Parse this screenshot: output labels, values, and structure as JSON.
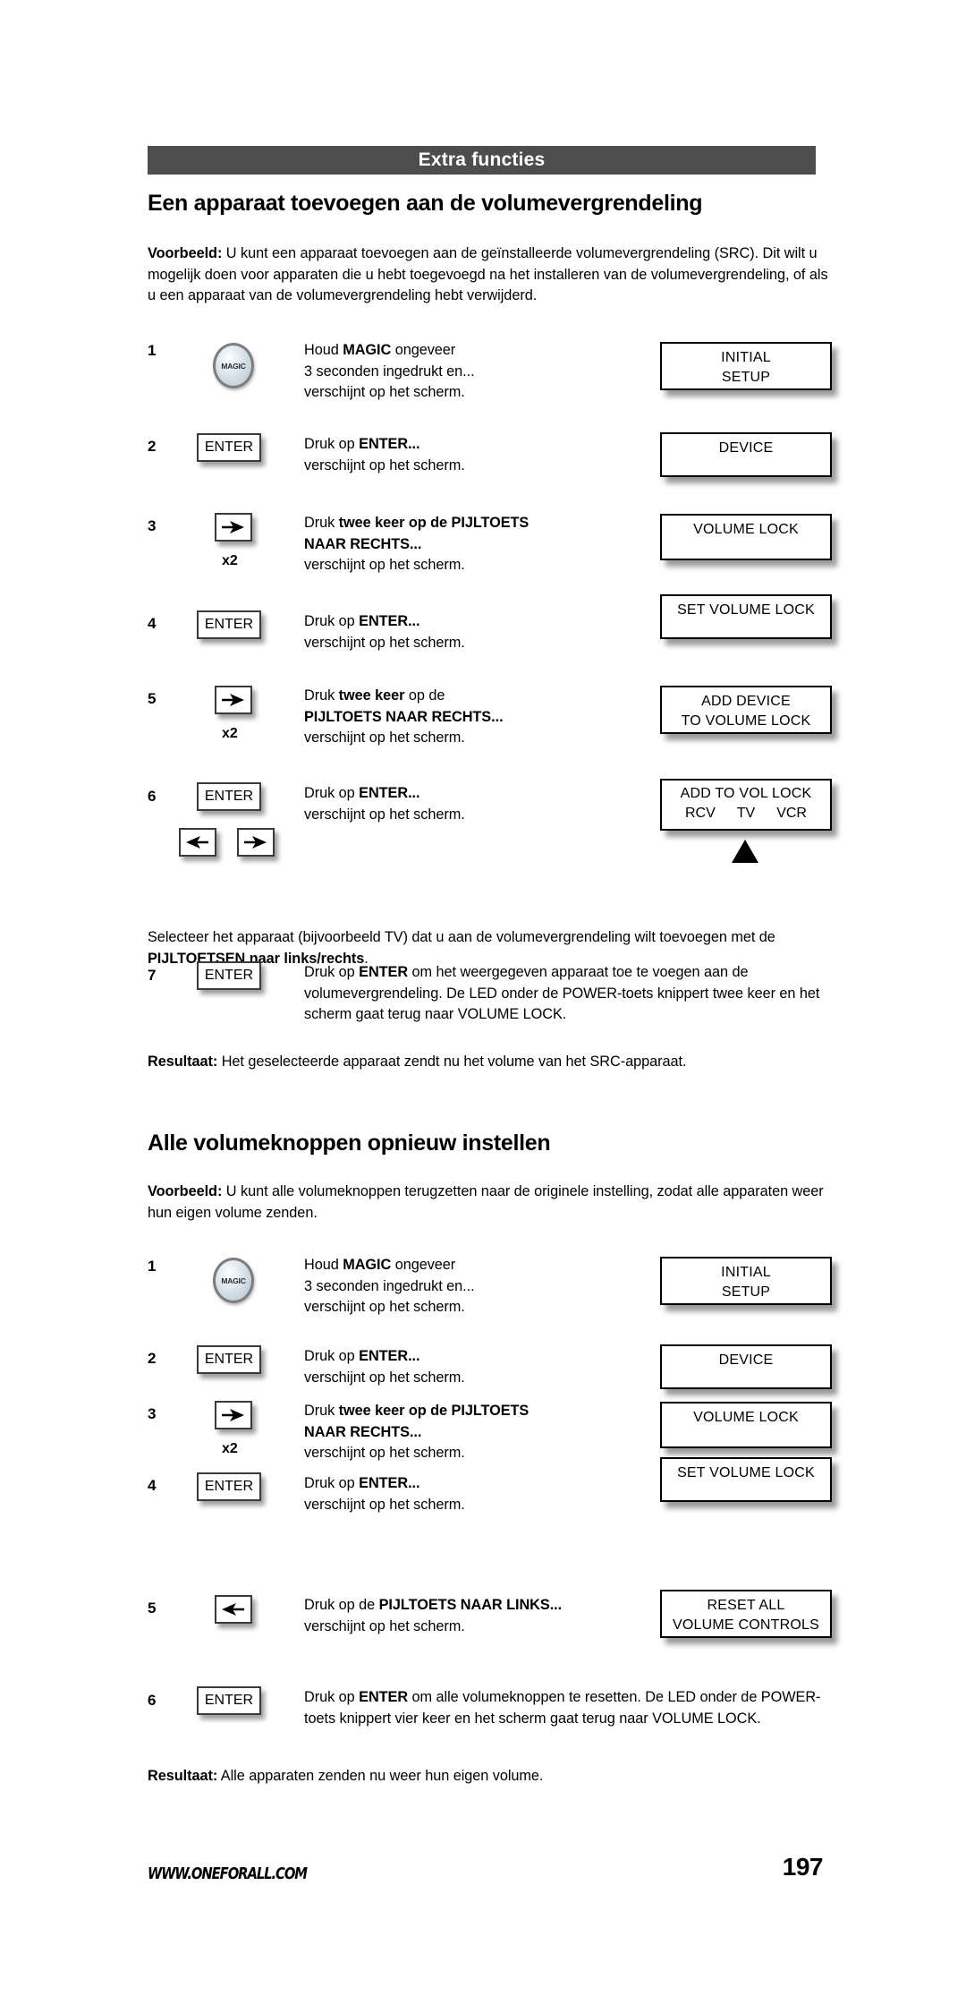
{
  "header": {
    "title": "Extra functies"
  },
  "footer": {
    "url": "WWW.ONEFORALL.COM",
    "page_number": "197"
  },
  "colors": {
    "header_bar": "#4d4d4d",
    "header_text": "#ffffff",
    "body_text": "#000000",
    "magic_key": "#cdd9e0"
  },
  "sections": [
    {
      "heading": "Een apparaat toevoegen aan de volumevergrendeling",
      "intro_label": "Voorbeeld:",
      "intro_text": " U kunt een apparaat toevoegen aan de geïnstalleerde volumevergrendeling (SRC). Dit wilt u mogelijk doen voor apparaten die u hebt toegevoegd na het installeren van de volumevergrendeling, of als u een apparaat van de volumevergrendeling hebt verwijderd.",
      "mid_text_pre": "Selecteer het apparaat (bijvoorbeeld TV) dat u aan de volumevergrendeling wilt toevoegen met de ",
      "mid_text_bold": "PIJLTOETSEN naar links/rechts",
      "mid_text_post": ".",
      "result_label": "Resultaat:",
      "result_text": " Het geselecteerde apparaat zendt nu het volume van het SRC-apparaat.",
      "steps": [
        {
          "number": "1",
          "key": "magic",
          "key_label": "MAGIC",
          "text_html": "Houd <b>MAGIC</b> ongeveer<br>3 seconden ingedrukt en...<br>verschijnt op het scherm.",
          "display_lines": [
            "INITIAL",
            "SETUP"
          ]
        },
        {
          "number": "2",
          "key": "enter",
          "key_label": "ENTER",
          "text_html": "Druk op <b>ENTER...</b><br>verschijnt op het scherm.",
          "display_lines": [
            "DEVICE"
          ]
        },
        {
          "number": "3",
          "key": "arrow-right",
          "repeat_label": "x2",
          "text_html": "Druk <b>twee keer op de PIJLTOETS<br>NAAR RECHTS...</b><br>verschijnt op het scherm.",
          "display_lines": [
            "VOLUME LOCK"
          ]
        },
        {
          "number": "4",
          "key": "enter",
          "key_label": "ENTER",
          "text_html": "Druk op <b>ENTER...</b><br>verschijnt op het scherm.",
          "display_lines": [
            "SET VOLUME LOCK"
          ]
        },
        {
          "number": "5",
          "key": "arrow-right",
          "repeat_label": "x2",
          "text_html": "Druk <b>twee keer</b> op de<br><b>PIJLTOETS NAAR RECHTS...</b><br>verschijnt op het scherm.",
          "display_lines": [
            "ADD DEVICE",
            "TO VOLUME LOCK"
          ]
        },
        {
          "number": "6",
          "key": "enter",
          "key_label": "ENTER",
          "text_html": "Druk op <b>ENTER...</b><br>verschijnt op het scherm.",
          "display_lines": [
            "ADD TO VOL LOCK"
          ],
          "display_devices": [
            "RCV",
            "TV",
            "VCR"
          ],
          "display_pointer_target": "TV",
          "extra_keys": [
            "arrow-left",
            "arrow-right"
          ]
        },
        {
          "number": "7",
          "key": "enter",
          "key_label": "ENTER",
          "text_html": "Druk op <b>ENTER</b> om het weergegeven apparaat toe te voegen aan de volumevergrendeling. De LED onder de POWER-toets knippert twee keer en het scherm gaat terug naar VOLUME LOCK."
        }
      ]
    },
    {
      "heading": "Alle volumeknoppen opnieuw instellen",
      "intro_label": "Voorbeeld:",
      "intro_text": " U kunt alle volumeknoppen terugzetten naar de originele instelling, zodat alle apparaten weer hun eigen volume zenden.",
      "result_label": "Resultaat:",
      "result_text": " Alle apparaten zenden nu weer hun eigen volume.",
      "steps": [
        {
          "number": "1",
          "key": "magic",
          "key_label": "MAGIC",
          "text_html": "Houd <b>MAGIC</b> ongeveer<br>3 seconden ingedrukt en...<br>verschijnt op het scherm.",
          "display_lines": [
            "INITIAL",
            "SETUP"
          ]
        },
        {
          "number": "2",
          "key": "enter",
          "key_label": "ENTER",
          "text_html": "Druk op <b>ENTER...</b><br>verschijnt op het scherm.",
          "display_lines": [
            "DEVICE"
          ]
        },
        {
          "number": "3",
          "key": "arrow-right",
          "repeat_label": "x2",
          "text_html": "Druk <b>twee keer op de PIJLTOETS<br>NAAR RECHTS...</b><br>verschijnt op het scherm.",
          "display_lines": [
            "VOLUME LOCK"
          ]
        },
        {
          "number": "4",
          "key": "enter",
          "key_label": "ENTER",
          "text_html": "Druk op <b>ENTER...</b><br>verschijnt op het scherm.",
          "display_lines": [
            "SET VOLUME LOCK"
          ]
        },
        {
          "number": "5",
          "key": "arrow-left",
          "text_html": "Druk op de <b>PIJLTOETS NAAR LINKS...</b><br>verschijnt op het scherm.",
          "display_lines": [
            "RESET ALL",
            "VOLUME CONTROLS"
          ]
        },
        {
          "number": "6",
          "key": "enter",
          "key_label": "ENTER",
          "text_html": "Druk op <b>ENTER</b> om alle volumeknoppen te resetten. De LED onder de POWER-toets knippert vier keer en het scherm gaat terug naar VOLUME LOCK."
        }
      ]
    }
  ]
}
